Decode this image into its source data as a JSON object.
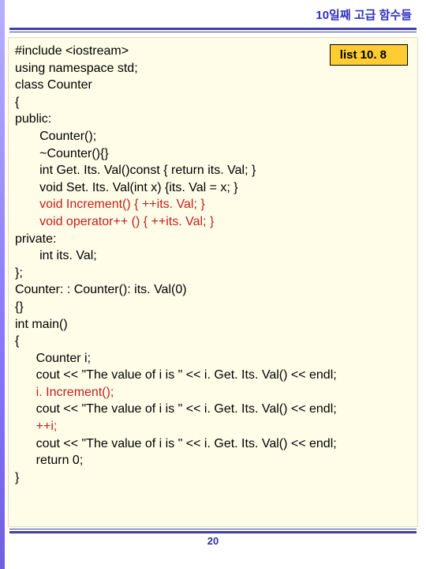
{
  "header": {
    "title": "10일째 고급 함수들"
  },
  "badge": {
    "label": "list 10. 8"
  },
  "code": {
    "l1": "#include <iostream>",
    "l2": "using namespace std;",
    "l3": "class Counter",
    "l4": "{",
    "l5": "public:",
    "l6": "       Counter();",
    "l7": "       ~Counter(){}",
    "l8": "       int Get. Its. Val()const { return its. Val; }",
    "l9": "       void Set. Its. Val(int x) {its. Val = x; }",
    "l10": "       void Increment() { ++its. Val; }",
    "l11": "       void operator++ () { ++its. Val; }",
    "l12": "private:",
    "l13": "       int its. Val;",
    "l14": "};",
    "l15": "Counter: : Counter(): its. Val(0)",
    "l16": "{}",
    "l17": "int main()",
    "l18": "{",
    "l19": "      Counter i;",
    "l20": "      cout << \"The value of i is \" << i. Get. Its. Val() << endl;",
    "l21": "      i. Increment();",
    "l22": "      cout << \"The value of i is \" << i. Get. Its. Val() << endl;",
    "l23": "      ++i;",
    "l24": "      cout << \"The value of i is \" << i. Get. Its. Val() << endl;",
    "l25": "      return 0;",
    "l26": "}"
  },
  "footer": {
    "page": "20"
  }
}
